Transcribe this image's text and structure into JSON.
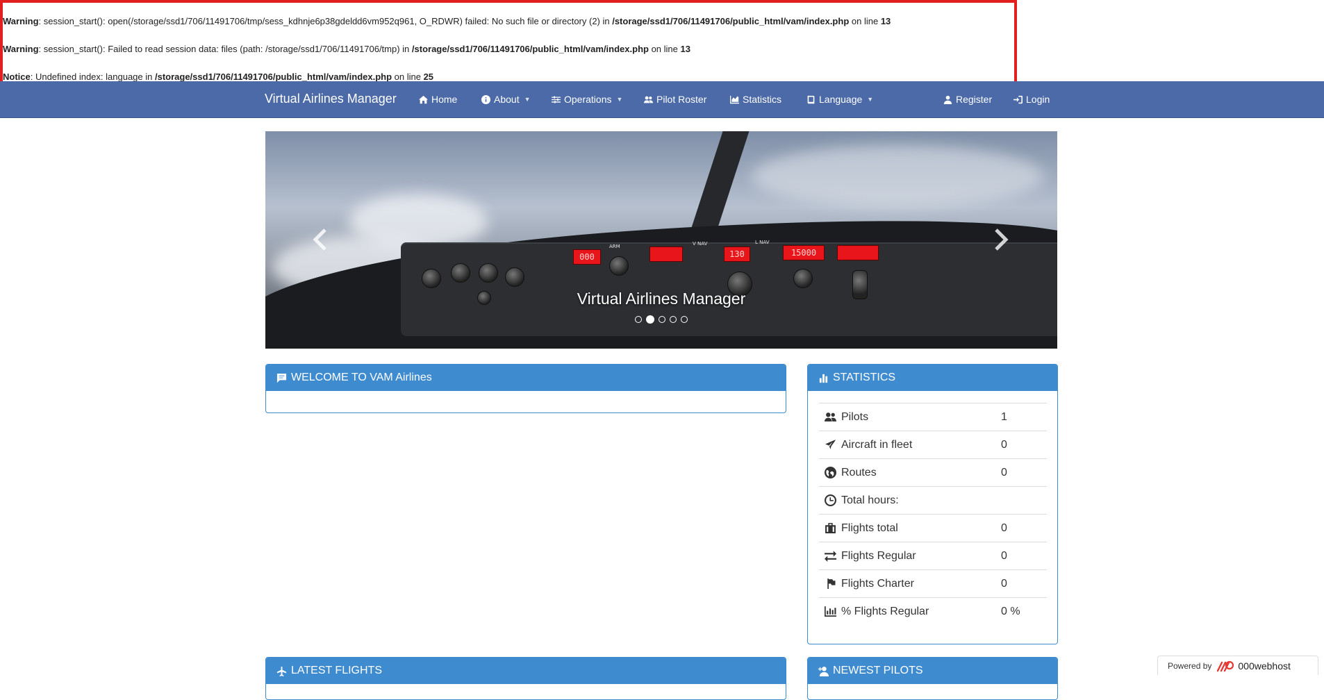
{
  "errors": [
    {
      "type": "Warning",
      "message": ": session_start(): open(/storage/ssd1/706/11491706/tmp/sess_kdhnje6p38gdeldd6vm952q961, O_RDWR) failed: No such file or directory (2) in ",
      "file": "/storage/ssd1/706/11491706/public_html/vam/index.php",
      "on_line": " on line ",
      "line": "13"
    },
    {
      "type": "Warning",
      "message": ": session_start(): Failed to read session data: files (path: /storage/ssd1/706/11491706/tmp) in ",
      "file": "/storage/ssd1/706/11491706/public_html/vam/index.php",
      "on_line": " on line ",
      "line": "13"
    },
    {
      "type": "Notice",
      "message": ": Undefined index: language in ",
      "file": "/storage/ssd1/706/11491706/public_html/vam/index.php",
      "on_line": " on line ",
      "line": "25"
    }
  ],
  "navbar": {
    "brand": "Virtual Airlines Manager",
    "items": [
      {
        "label": "Home",
        "icon": "home-icon"
      },
      {
        "label": "About",
        "icon": "info-icon",
        "dropdown": true
      },
      {
        "label": "Operations",
        "icon": "sliders-icon",
        "dropdown": true
      },
      {
        "label": "Pilot Roster",
        "icon": "users-icon"
      },
      {
        "label": "Statistics",
        "icon": "chart-icon"
      },
      {
        "label": "Language",
        "icon": "book-icon",
        "dropdown": true
      },
      {
        "label": "Register",
        "icon": "user-icon"
      },
      {
        "label": "Login",
        "icon": "login-icon"
      }
    ]
  },
  "carousel": {
    "caption": "Virtual Airlines Manager",
    "slide_count": 5,
    "active_index": 1,
    "panel_displays": [
      "000",
      "130",
      "15000"
    ]
  },
  "welcome_panel": {
    "title": "WELCOME TO VAM Airlines"
  },
  "statistics_panel": {
    "title": "STATISTICS",
    "rows": [
      {
        "icon": "users-icon",
        "label": "Pilots",
        "value": "1"
      },
      {
        "icon": "plane-icon",
        "label": "Aircraft in fleet",
        "value": "0"
      },
      {
        "icon": "globe-icon",
        "label": "Routes",
        "value": "0"
      },
      {
        "icon": "clock-icon",
        "label": "Total hours:",
        "value": ""
      },
      {
        "icon": "suitcase-icon",
        "label": "Flights total",
        "value": "0"
      },
      {
        "icon": "exchange-icon",
        "label": "Flights Regular",
        "value": "0"
      },
      {
        "icon": "flag-icon",
        "label": "Flights Charter",
        "value": "0"
      },
      {
        "icon": "bar-chart-icon",
        "label": "% Flights Regular",
        "value": "0 %"
      }
    ]
  },
  "latest_flights_panel": {
    "title": "LATEST FLIGHTS"
  },
  "newest_pilots_panel": {
    "title": "NEWEST PILOTS"
  },
  "footer": {
    "powered_by": "Powered by",
    "host": "000webhost"
  },
  "colors": {
    "navbar": "#4b6aa7",
    "panel_heading": "#3f8bd0",
    "error_border": "#e32020",
    "host_logo": "#e53935"
  }
}
